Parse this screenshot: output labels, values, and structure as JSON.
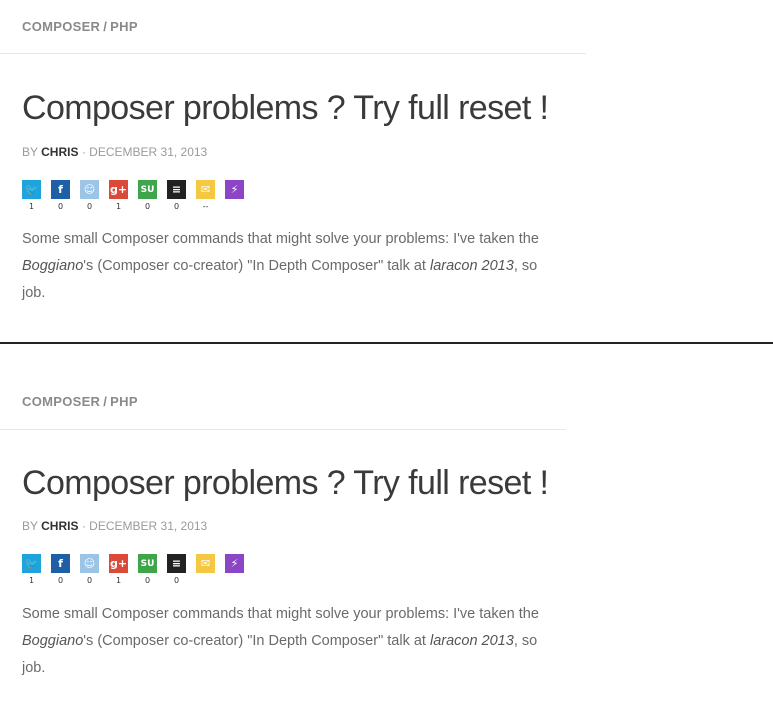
{
  "post": {
    "category_1": "COMPOSER",
    "category_separator": "/",
    "category_2": "PHP",
    "title": "Composer problems ? Try full reset !",
    "by_label": "BY",
    "author": "CHRIS",
    "date_separator": "·",
    "date": "DECEMBER 31, 2013",
    "share": [
      {
        "network": "twitter",
        "icon": "twitter-icon",
        "glyph": "🐦",
        "count": "1",
        "color": "#1fa3dd"
      },
      {
        "network": "facebook",
        "icon": "facebook-icon",
        "glyph": "f",
        "count": "0",
        "color": "#1e5fa6"
      },
      {
        "network": "reddit",
        "icon": "reddit-icon",
        "glyph": "☺",
        "count": "0",
        "color": "#9cc4e6"
      },
      {
        "network": "googleplus",
        "icon": "googleplus-icon",
        "glyph": "g+",
        "count": "1",
        "color": "#db4a39"
      },
      {
        "network": "stumbleupon",
        "icon": "stumbleupon-icon",
        "glyph": "SU",
        "count": "0",
        "color": "#3fa54b"
      },
      {
        "network": "buffer",
        "icon": "buffer-icon",
        "glyph": "≡",
        "count": "0",
        "color": "#222222"
      },
      {
        "network": "email",
        "icon": "email-icon",
        "glyph": "✉",
        "count": "--",
        "color": "#f4c842"
      },
      {
        "network": "flattr",
        "icon": "flattr-icon",
        "glyph": "⚡",
        "count": "",
        "color": "#8d45c8"
      }
    ],
    "excerpt_line1": "Some small Composer commands that might solve your problems: I've taken the",
    "excerpt_line2_name": "Boggiano",
    "excerpt_line2_mid": "'s (Composer co-creator) \"In Depth Composer\" talk at ",
    "excerpt_line2_event": "laracon 2013",
    "excerpt_line2_end": ", so",
    "excerpt_line3": "job."
  }
}
